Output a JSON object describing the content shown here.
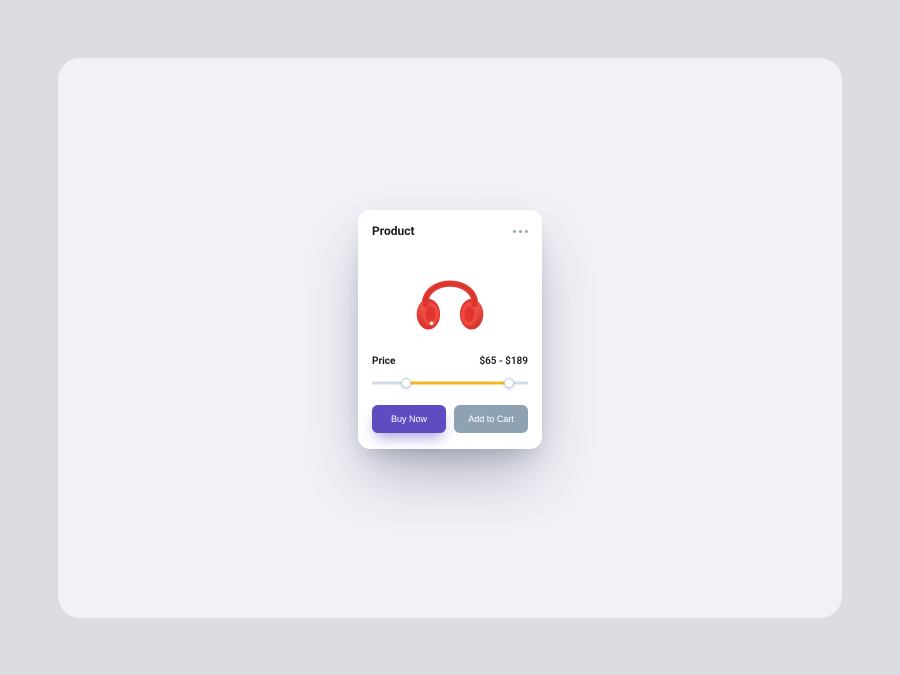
{
  "card": {
    "title": "Product",
    "price_label": "Price",
    "price_value": "$65 - $189",
    "buttons": {
      "primary": "Buy Now",
      "secondary": "Add to Cart"
    },
    "slider": {
      "min_percent": 22,
      "max_percent": 88
    }
  }
}
